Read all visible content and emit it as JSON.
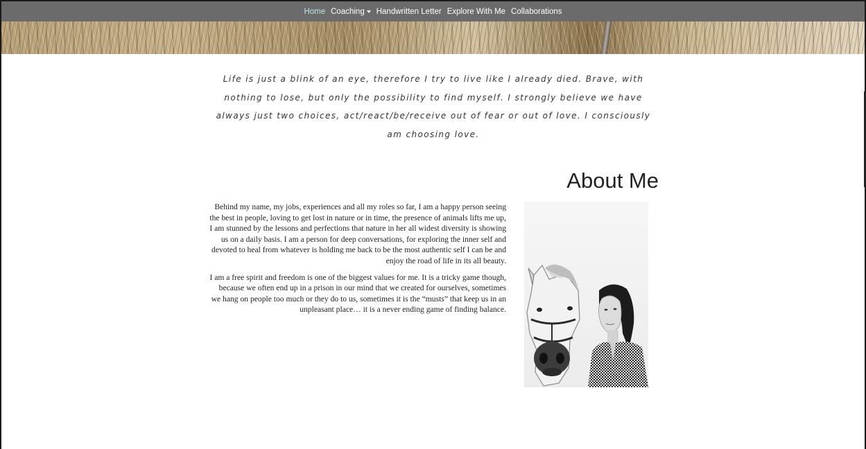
{
  "nav": {
    "items": [
      {
        "label": "Home",
        "active": true
      },
      {
        "label": "Coaching",
        "dropdown": true
      },
      {
        "label": "Handwritten Letter"
      },
      {
        "label": "Explore With Me"
      },
      {
        "label": "Collaborations"
      }
    ],
    "background": "#6b6b6b",
    "active_color": "#bfe3e8"
  },
  "quote": {
    "text": "Life is just a blink of an eye, therefore I try to live like I already died. Brave, with nothing to lose, but only the possibility to find myself. I strongly believe we have always just two choices, act/react/be/receive out of fear or out of love. I consciously am choosing love."
  },
  "about": {
    "heading": "About Me",
    "paragraphs": [
      "Behind my name, my jobs, experiences and all my roles so far, I am a happy person seeing the best in people, loving to get lost in nature or in time, the presence of animals lifts me up, I am stunned by the lessons and perfections that nature in her all widest diversity is showing us on a daily basis. I am a person for deep conversations, for exploring the inner self and devoted to heal from whatever is holding me back to be the most authentic self I can be and enjoy the road of life in its all beauty.",
      "I am a free spirit and freedom is one of the biggest values for me. It is a tricky game though, because we often end up in a prison in our mind that we created for ourselves, sometimes we hang on people too much or they do to us, sometimes it is the “musts” that keep us in an unpleasant place… it is a never ending game of finding balance."
    ],
    "photo_subject": "woman-with-horse-photo"
  }
}
